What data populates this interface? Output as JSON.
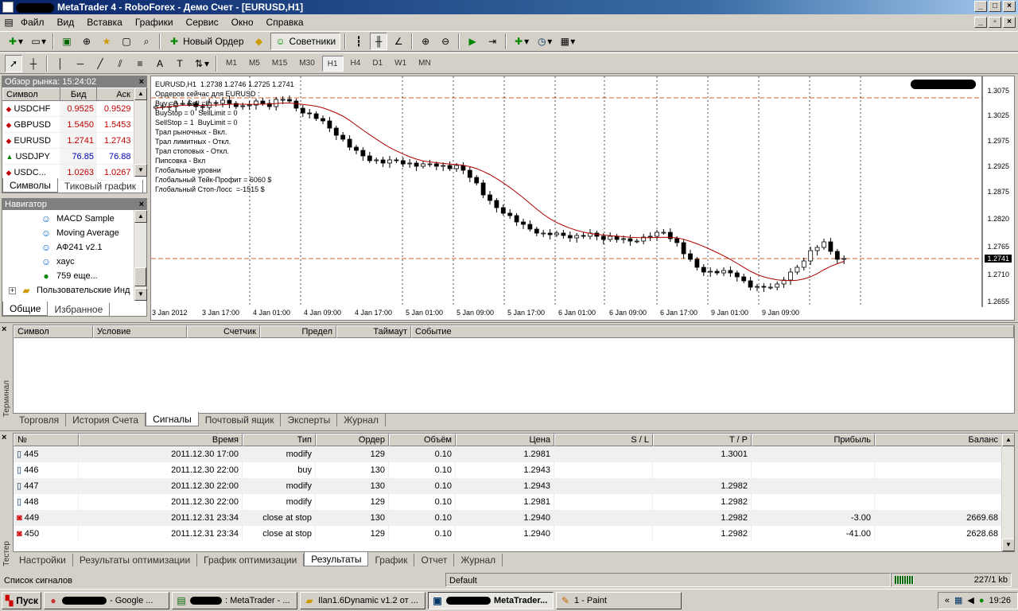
{
  "window": {
    "title": "MetaTrader 4 - RoboForex - Демо Счет - [EURUSD,H1]"
  },
  "menu": [
    "Файл",
    "Вид",
    "Вставка",
    "Графики",
    "Сервис",
    "Окно",
    "Справка"
  ],
  "toolbar": {
    "new_order": "Новый Ордер",
    "experts": "Советники"
  },
  "timeframes": [
    "M1",
    "M5",
    "M15",
    "M30",
    "H1",
    "H4",
    "D1",
    "W1",
    "MN"
  ],
  "timeframe_selected": "H1",
  "market_watch": {
    "title": "Обзор рынка: 15:24:02",
    "columns": [
      "Символ",
      "Бид",
      "Аск"
    ],
    "rows": [
      {
        "symbol": "USDCHF",
        "bid": "0.9525",
        "ask": "0.9529",
        "dir": "down"
      },
      {
        "symbol": "GBPUSD",
        "bid": "1.5450",
        "ask": "1.5453",
        "dir": "down"
      },
      {
        "symbol": "EURUSD",
        "bid": "1.2741",
        "ask": "1.2743",
        "dir": "down"
      },
      {
        "symbol": "USDJPY",
        "bid": "76.85",
        "ask": "76.88",
        "dir": "up"
      },
      {
        "symbol": "USDC...",
        "bid": "1.0263",
        "ask": "1.0267",
        "dir": "down"
      }
    ],
    "tabs": [
      "Символы",
      "Тиковый график"
    ]
  },
  "navigator": {
    "title": "Навигатор",
    "items": [
      "MACD Sample",
      "Moving Average",
      "АФ241 v2.1",
      "xayc",
      "759 еще...",
      "Пользовательские Инд"
    ],
    "tabs": [
      "Общие",
      "Избранное"
    ]
  },
  "chart": {
    "symbol_line": "EURUSD,H1  1.2738 1.2746 1.2725 1.2741",
    "info_lines": [
      "Ордеров сейчас для EURUSD :",
      "Buy =0     Sell =0",
      "BuyStop = 0  SellLimit = 0",
      "SellStop = 1  BuyLimit = 0",
      "Трал рыночных - Вкл.",
      "Трал лимитных - Откл.",
      "Трал стоповых - Откл.",
      "Пипсовка - Вкл",
      "Глобальные уровни",
      "Глобальный Тейк-Профит = 6060 $",
      "Глобальный Стоп-Лосс  =-1515 $"
    ],
    "price_labels": [
      "1.3075",
      "1.3025",
      "1.2975",
      "1.2925",
      "1.2875",
      "1.2820",
      "1.2765",
      "1.2710",
      "1.2655"
    ],
    "current_price": "1.2741",
    "time_labels": [
      "3 Jan 2012",
      "3 Jan 17:00",
      "4 Jan 01:00",
      "4 Jan 09:00",
      "4 Jan 17:00",
      "5 Jan 01:00",
      "5 Jan 09:00",
      "5 Jan 17:00",
      "6 Jan 01:00",
      "6 Jan 09:00",
      "6 Jan 17:00",
      "9 Jan 01:00",
      "9 Jan 09:00"
    ]
  },
  "terminal": {
    "label": "Терминал",
    "columns": [
      "Символ",
      "Условие",
      "Счетчик",
      "Предел",
      "Таймаут",
      "Событие"
    ],
    "tabs": [
      "Торговля",
      "История Счета",
      "Сигналы",
      "Почтовый ящик",
      "Эксперты",
      "Журнал"
    ],
    "selected_tab": "Сигналы"
  },
  "tester": {
    "label": "Тестер",
    "columns": [
      "№",
      "Время",
      "Тип",
      "Ордер",
      "Объём",
      "Цена",
      "S / L",
      "T / P",
      "Прибыль",
      "Баланс"
    ],
    "rows": [
      [
        "445",
        "2011.12.30 17:00",
        "modify",
        "129",
        "0.10",
        "1.2981",
        "",
        "1.3001",
        "",
        ""
      ],
      [
        "446",
        "2011.12.30 22:00",
        "buy",
        "130",
        "0.10",
        "1.2943",
        "",
        "",
        "",
        ""
      ],
      [
        "447",
        "2011.12.30 22:00",
        "modify",
        "130",
        "0.10",
        "1.2943",
        "",
        "1.2982",
        "",
        ""
      ],
      [
        "448",
        "2011.12.30 22:00",
        "modify",
        "129",
        "0.10",
        "1.2981",
        "",
        "1.2982",
        "",
        ""
      ],
      [
        "449",
        "2011.12.31 23:34",
        "close at stop",
        "130",
        "0.10",
        "1.2940",
        "",
        "1.2982",
        "-3.00",
        "2669.68"
      ],
      [
        "450",
        "2011.12.31 23:34",
        "close at stop",
        "129",
        "0.10",
        "1.2940",
        "",
        "1.2982",
        "-41.00",
        "2628.68"
      ]
    ],
    "tabs": [
      "Настройки",
      "Результаты оптимизации",
      "График оптимизации",
      "Результаты",
      "График",
      "Отчет",
      "Журнал"
    ],
    "selected_tab": "Результаты"
  },
  "status": {
    "left": "Список сигналов",
    "profile": "Default",
    "traffic": "227/1 kb"
  },
  "taskbar": {
    "start": "Пуск",
    "items": [
      "- Google ...",
      ": MetaTrader - ...",
      "Ilan1.6Dynamic v1.2 от ...",
      "MetaTrader...",
      "1 - Paint"
    ],
    "clock": "19:26"
  }
}
